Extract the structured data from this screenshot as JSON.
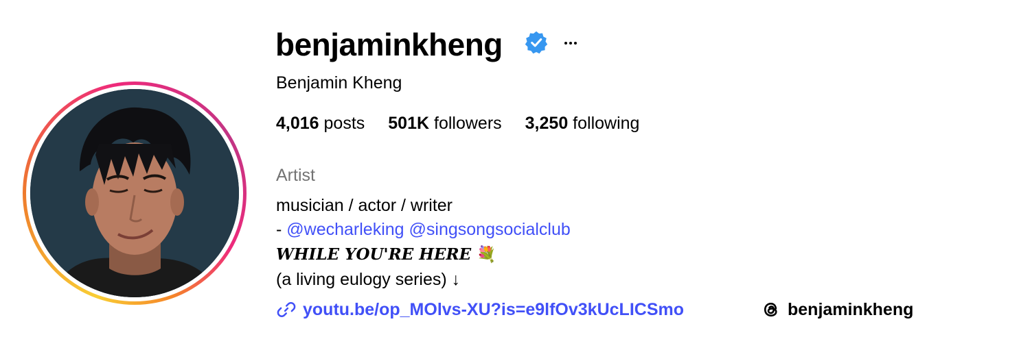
{
  "profile": {
    "username": "benjaminkheng",
    "full_name": "Benjamin Kheng",
    "verified_icon": "verified-badge-icon",
    "more_icon": "more-options-icon"
  },
  "stats": {
    "posts_count": "4,016",
    "posts_label": "posts",
    "followers_count": "501K",
    "followers_label": "followers",
    "following_count": "3,250",
    "following_label": "following"
  },
  "bio": {
    "category": "Artist",
    "line1": "musician / actor / writer",
    "line2_prefix": "- ",
    "mention1": "@wecharleking",
    "mention2": "@singsongsocialclub",
    "line3_text": "WHILE YOU'RE HERE",
    "line3_emoji": "💐",
    "line4": "(a living eulogy series) ↓"
  },
  "links": {
    "website_icon": "link-icon",
    "website": "youtu.be/op_MOlvs-XU?is=e9lfOv3kUcLICSmo",
    "threads_icon": "threads-icon",
    "threads_handle": "benjaminkheng"
  },
  "colors": {
    "link_blue": "#4150f7",
    "verified_blue": "#3797f0",
    "secondary_text": "#737373"
  }
}
